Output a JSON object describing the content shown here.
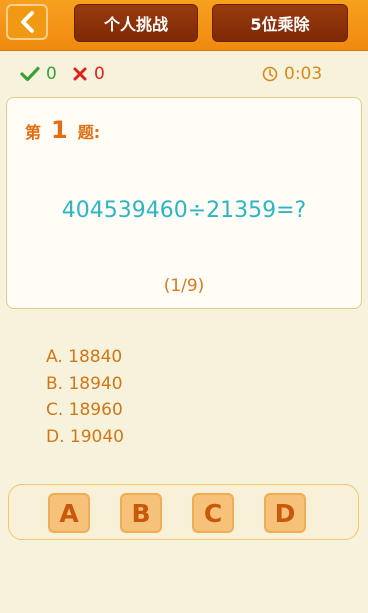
{
  "header": {
    "back_icon": "chevron-left-icon",
    "tab_personal": "个人挑战",
    "tab_mode": "5位乘除"
  },
  "status": {
    "correct_icon": "checkmark-icon",
    "correct_count": "0",
    "wrong_icon": "cross-icon",
    "wrong_count": "0",
    "timer_icon": "clock-icon",
    "timer": "0:03"
  },
  "question": {
    "prefix": "第",
    "number": "1",
    "suffix": "题:",
    "expression": "404539460÷21359=?",
    "progress": "(1/9)"
  },
  "options": [
    {
      "text": "A. 18840"
    },
    {
      "text": "B. 18940"
    },
    {
      "text": "C. 18960"
    },
    {
      "text": "D. 19040"
    }
  ],
  "answers": [
    {
      "label": "A"
    },
    {
      "label": "B"
    },
    {
      "label": "C"
    },
    {
      "label": "D"
    }
  ],
  "colors": {
    "header": "#f39a18",
    "tab": "#8a300a",
    "accent_text": "#e06e14",
    "expression": "#2fb4c4",
    "background": "#f7f2dc"
  }
}
